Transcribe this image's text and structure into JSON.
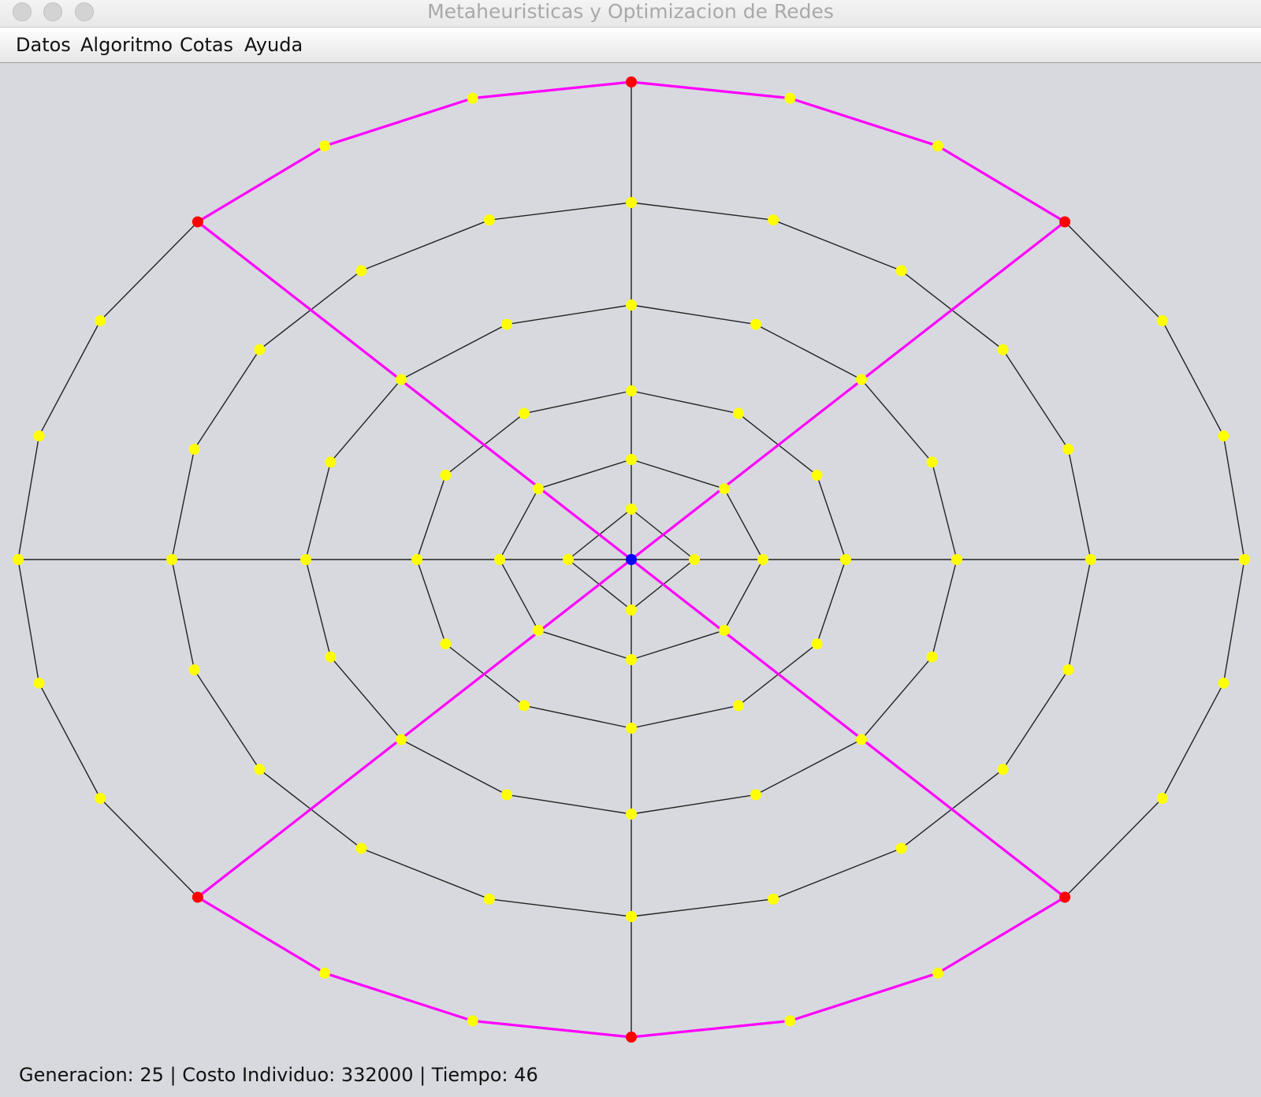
{
  "window": {
    "title": "Metaheuristicas y Optimizacion de Redes"
  },
  "menu": {
    "items": [
      "Datos",
      "Algoritmo",
      "Cotas",
      "Ayuda"
    ]
  },
  "status": {
    "text": "Generacion: 25 | Costo Individuo: 332000 | Tiempo: 46"
  },
  "graph": {
    "colors": {
      "background": "#d7d9de",
      "edge": "#222222",
      "highlight_edge": "#ff00ff",
      "node_default": "#ffff00",
      "node_special": "#ff0000",
      "node_root": "#0000ff"
    },
    "ring_sides": [
      4,
      8,
      12,
      16,
      20,
      24
    ],
    "spokes": 4,
    "special_nodes": [
      "top",
      "bottom",
      "upper-left",
      "upper-right",
      "lower-left",
      "lower-right"
    ],
    "highlight": [
      "two diagonals through the center",
      "outer ring top arc",
      "outer ring bottom arc"
    ]
  }
}
